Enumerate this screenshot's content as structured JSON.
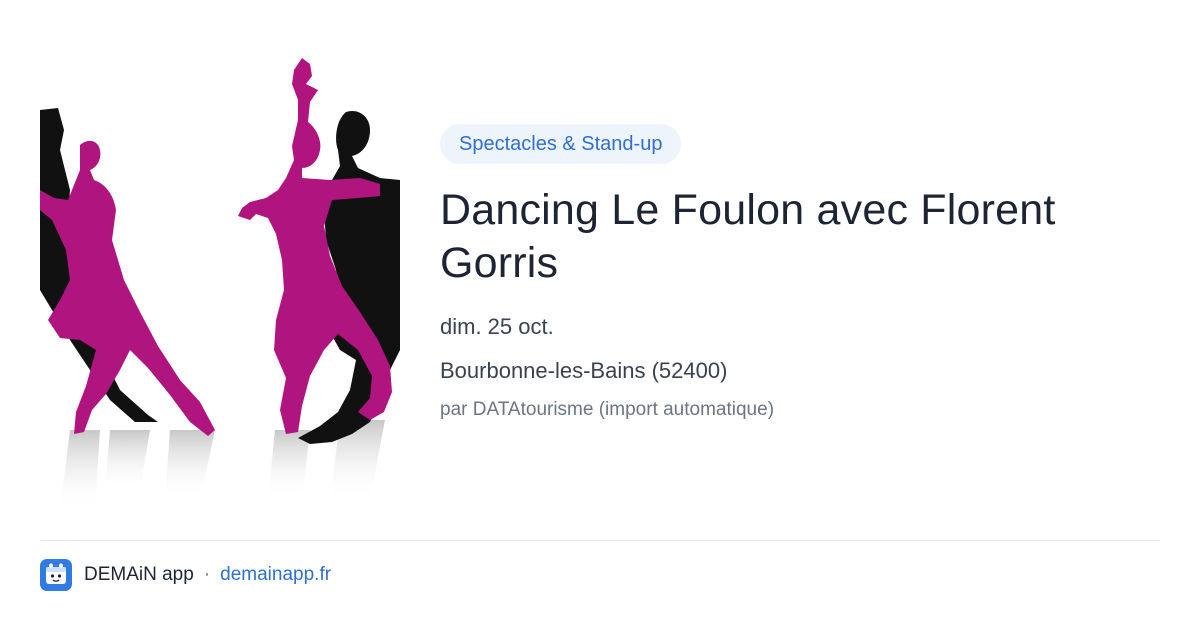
{
  "category": "Spectacles & Stand-up",
  "event": {
    "title": "Dancing Le Foulon avec Florent Gorris",
    "date": "dim. 25 oct.",
    "location": "Bourbonne-les-Bains (52400)",
    "source": "par DATAtourisme (import automatique)"
  },
  "image": {
    "description_icon": "dancers-silhouette-image"
  },
  "footer": {
    "app_name": "DEMAiN app",
    "separator": "·",
    "link": "demainapp.fr"
  },
  "colors": {
    "accent": "#2f6fd0",
    "badge_bg": "#eef4fc",
    "dancer_pink": "#b0147f",
    "dancer_black": "#111111"
  }
}
